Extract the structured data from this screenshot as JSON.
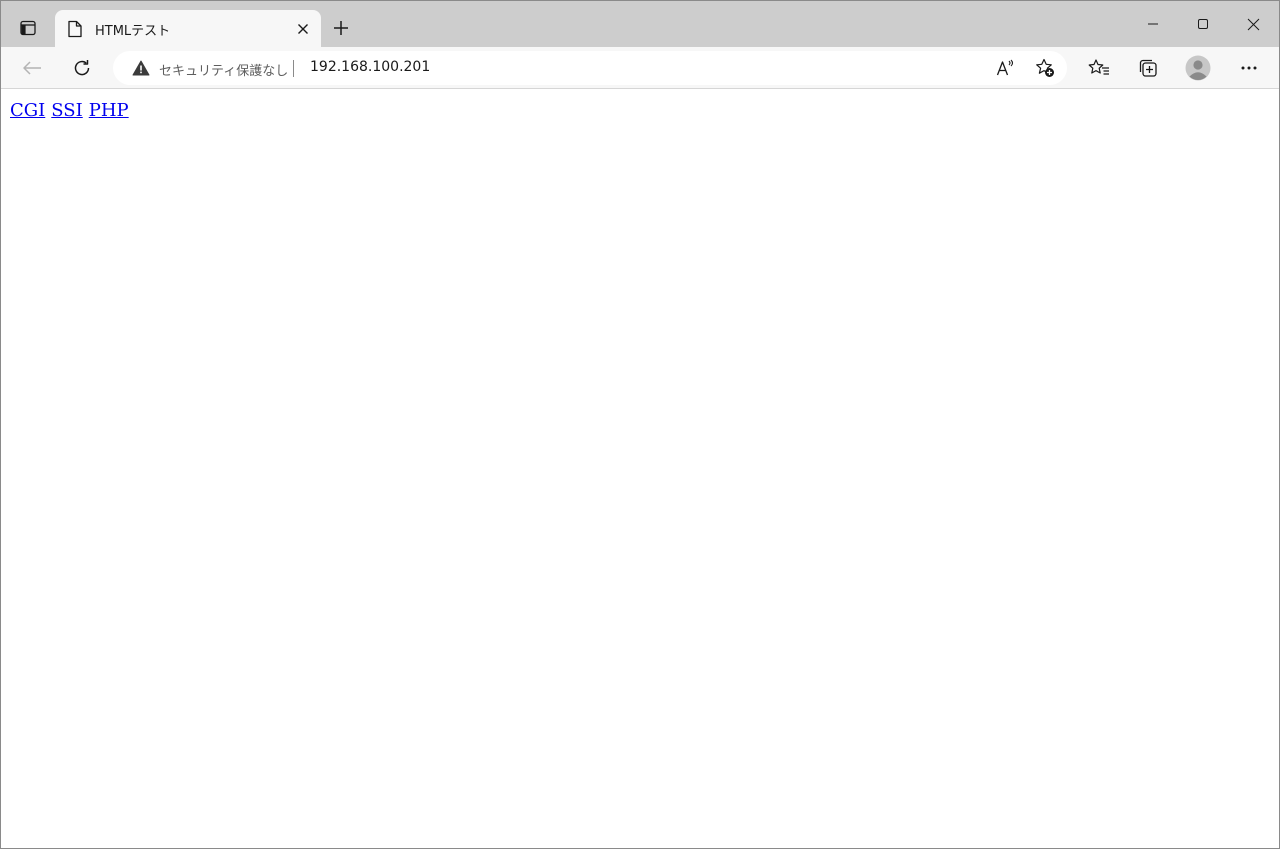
{
  "tab": {
    "title": "HTMLテスト"
  },
  "address_bar": {
    "security_label": "セキュリティ保護なし",
    "url": "192.168.100.201"
  },
  "page": {
    "links": [
      {
        "label": "CGI"
      },
      {
        "label": "SSI"
      },
      {
        "label": "PHP"
      }
    ]
  },
  "icons": {
    "tab_actions": "tab-actions-icon",
    "tab_favicon": "document-icon",
    "tab_close": "close-icon",
    "new_tab": "plus-icon",
    "minimize": "minimize-icon",
    "maximize": "maximize-icon",
    "close_window": "close-icon",
    "back": "arrow-left-icon",
    "refresh": "refresh-icon",
    "security": "warning-icon",
    "read_aloud": "read-aloud-icon",
    "add_favorite": "star-add-icon",
    "favorites": "favorites-icon",
    "collections": "collections-icon",
    "profile": "avatar-icon",
    "menu": "more-icon"
  },
  "colors": {
    "tabstrip_bg": "#cdcdcd",
    "toolbar_bg": "#f7f7f7",
    "link": "#0000ee"
  }
}
